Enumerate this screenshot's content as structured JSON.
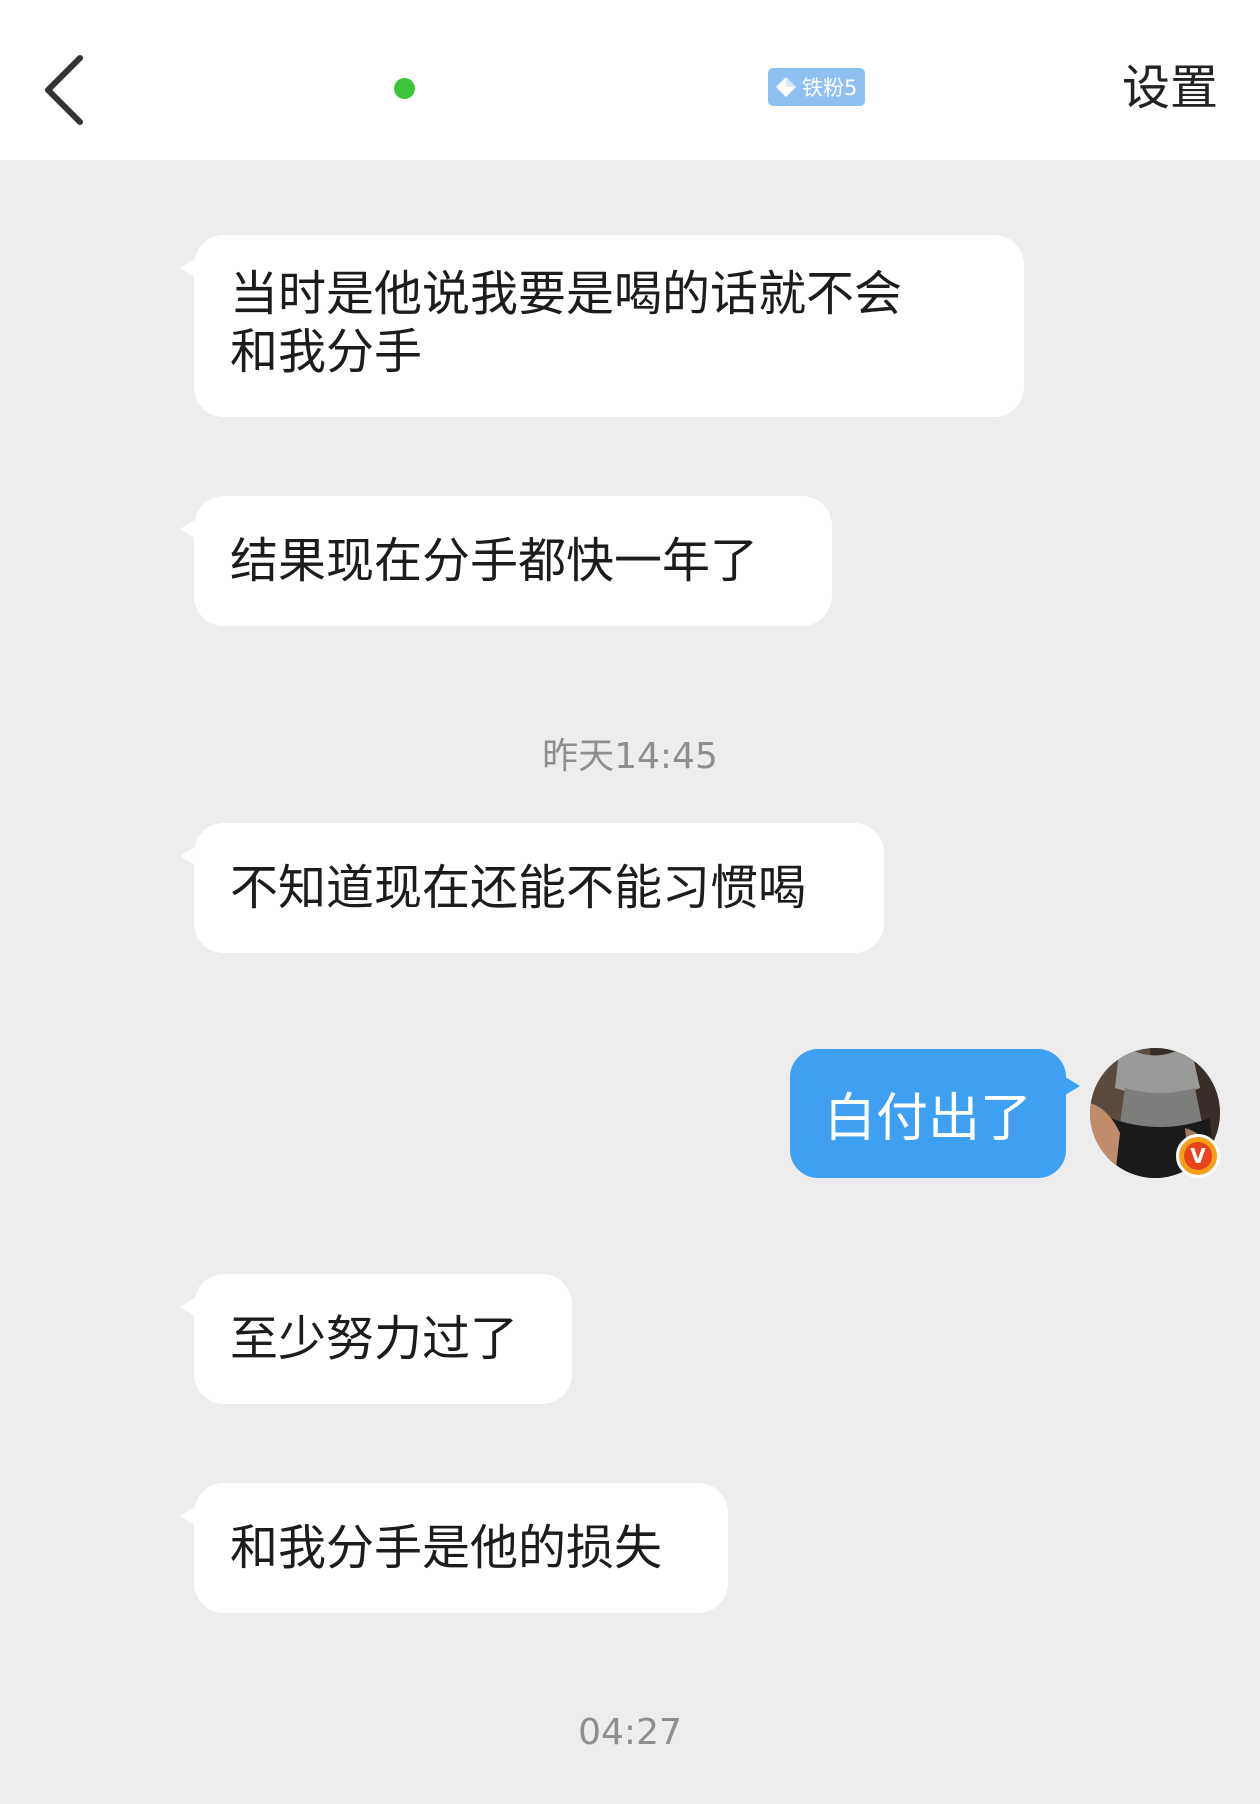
{
  "header": {
    "back_icon": "back-arrow-icon",
    "online_color": "#3ac43a",
    "badge_label": "铁粉5",
    "badge_icon": "diamond-icon",
    "settings_label": "设置"
  },
  "messages": [
    {
      "side": "in",
      "lines": [
        "当时是他说我要是喝的话就不会",
        "和我分手"
      ]
    },
    {
      "side": "in",
      "text": "结果现在分手都快一年了"
    },
    {
      "time": "昨天14:45"
    },
    {
      "side": "in",
      "text": "不知道现在还能不能习惯喝"
    },
    {
      "side": "out",
      "text": "白付出了"
    },
    {
      "side": "in",
      "text": "至少努力过了"
    },
    {
      "side": "in",
      "text": "和我分手是他的损失"
    },
    {
      "time": "04:27"
    }
  ],
  "colors": {
    "background": "#ededed",
    "incoming_bubble": "#ffffff",
    "outgoing_bubble": "#3f9ff2",
    "badge": "#8fc0f2"
  },
  "avatar": {
    "icon": "user-avatar",
    "verified_icon": "verified-v-icon",
    "verified_label": "V"
  }
}
